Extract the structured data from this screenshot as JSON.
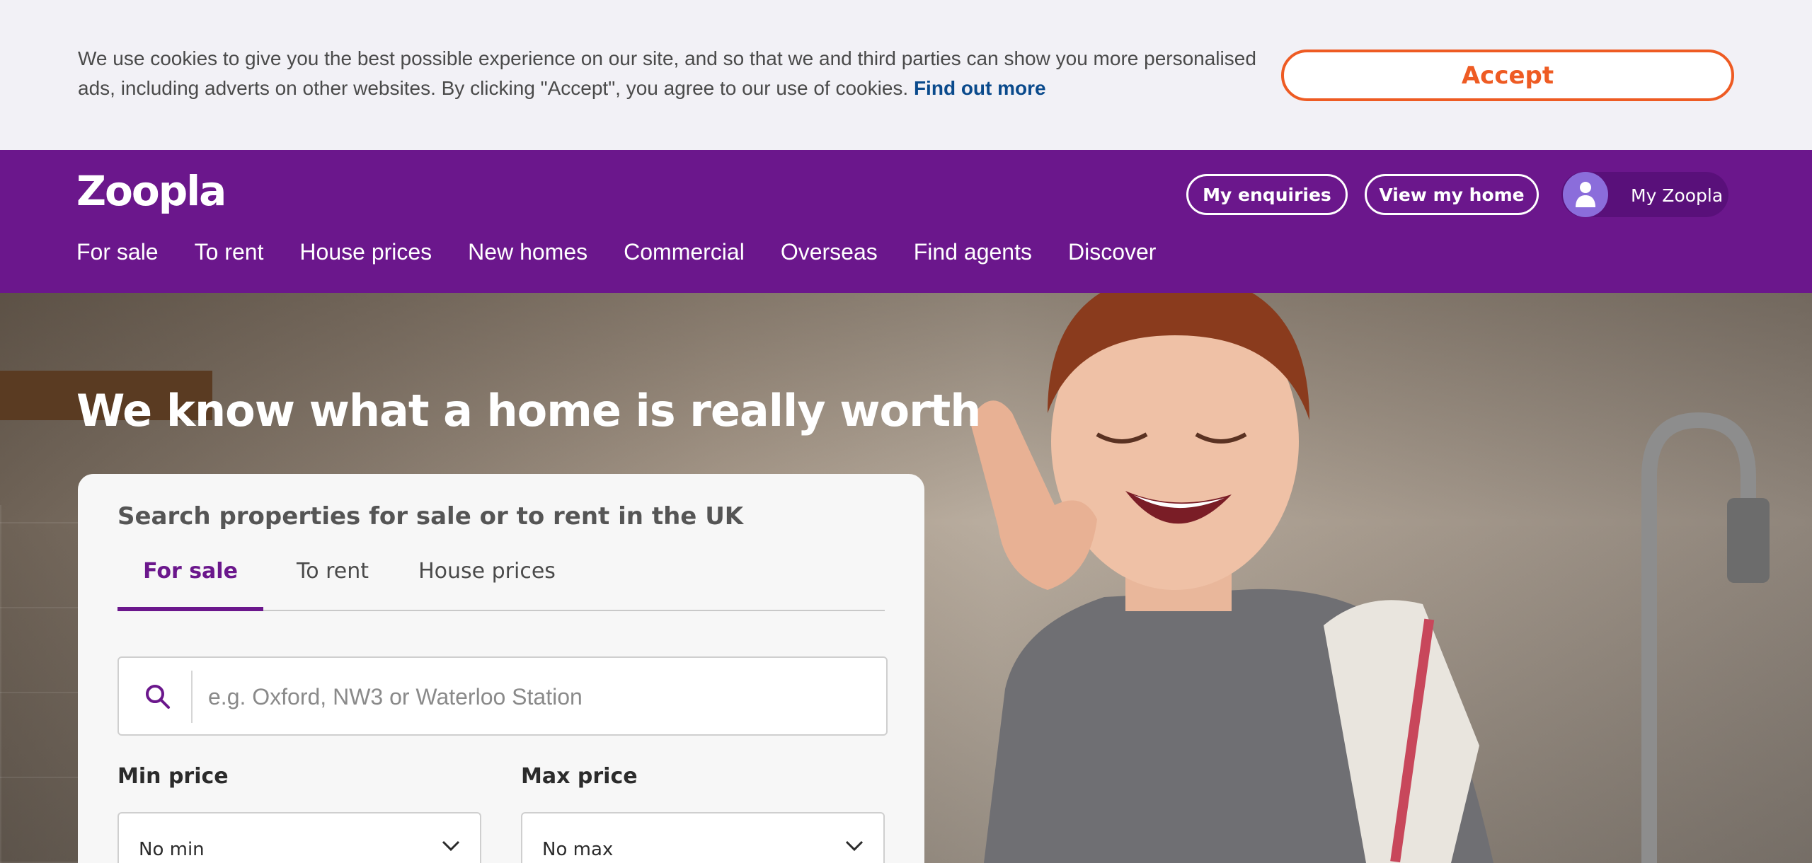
{
  "cookie": {
    "text": "We use cookies to give you the best possible experience on our site, and so that we and third parties can show you more personalised ads, including adverts on other websites. By clicking \"Accept\", you agree to our use of cookies.",
    "link_label": "Find out more",
    "accept_label": "Accept"
  },
  "header": {
    "logo": "Zoopla",
    "my_enquiries_label": "My enquiries",
    "view_my_home_label": "View my home",
    "my_zoopla_label": "My Zoopla",
    "nav": [
      "For sale",
      "To rent",
      "House prices",
      "New homes",
      "Commercial",
      "Overseas",
      "Find agents",
      "Discover"
    ]
  },
  "hero": {
    "title": "We know what a home is really worth"
  },
  "search": {
    "heading": "Search properties for sale or to rent in the UK",
    "tabs": [
      "For sale",
      "To rent",
      "House prices"
    ],
    "active_tab": "For sale",
    "placeholder": "e.g. Oxford, NW3 or Waterloo Station",
    "min_price_label": "Min price",
    "max_price_label": "Max price",
    "min_price_value": "No min",
    "max_price_value": "No max"
  },
  "colors": {
    "brand_purple": "#6b178c",
    "accent_orange": "#ee5b23",
    "link_blue": "#0a4a8c"
  },
  "icons": [
    "search-icon",
    "user-icon",
    "chevron-down-icon"
  ]
}
